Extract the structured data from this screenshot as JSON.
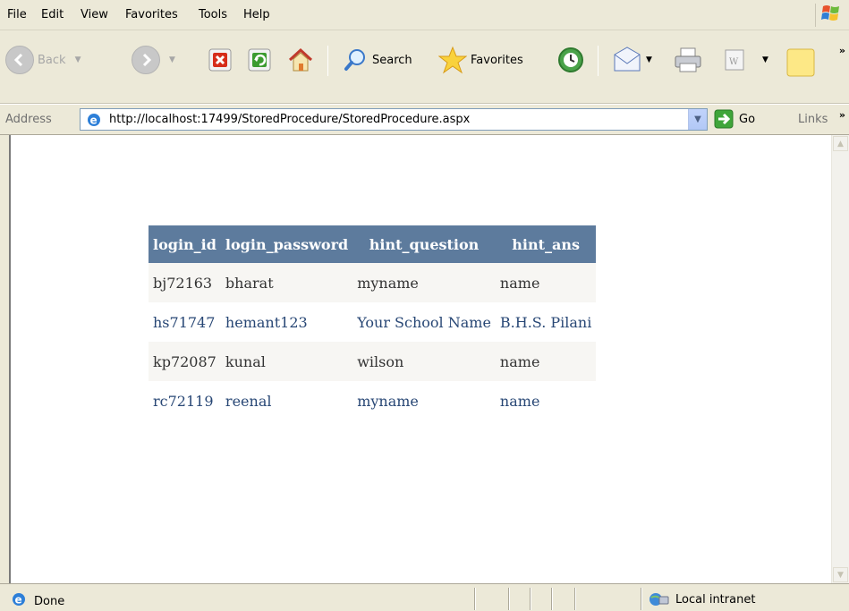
{
  "menu": {
    "items": [
      "File",
      "Edit",
      "View",
      "Favorites",
      "Tools",
      "Help"
    ]
  },
  "toolbar": {
    "back_label": "Back",
    "search_label": "Search",
    "favorites_label": "Favorites"
  },
  "address": {
    "label": "Address",
    "url": "http://localhost:17499/StoredProcedure/StoredProcedure.aspx",
    "go_label": "Go",
    "links_label": "Links"
  },
  "table": {
    "headers": [
      "login_id",
      "login_password",
      "hint_question",
      "hint_ans"
    ],
    "rows": [
      [
        "bj72163",
        "bharat",
        "myname",
        "name"
      ],
      [
        "hs71747",
        "hemant123",
        "Your School Name",
        "B.H.S. Pilani"
      ],
      [
        "kp72087",
        "kunal",
        "wilson",
        "name"
      ],
      [
        "rc72119",
        "reenal",
        "myname",
        "name"
      ]
    ]
  },
  "status": {
    "text": "Done",
    "zone": "Local intranet"
  },
  "colors": {
    "header_bg": "#5d7b9d",
    "row_odd_bg": "#f7f6f3",
    "row_odd_text": "#333333",
    "row_even_text": "#284775",
    "chrome_bg": "#ece9d8"
  }
}
